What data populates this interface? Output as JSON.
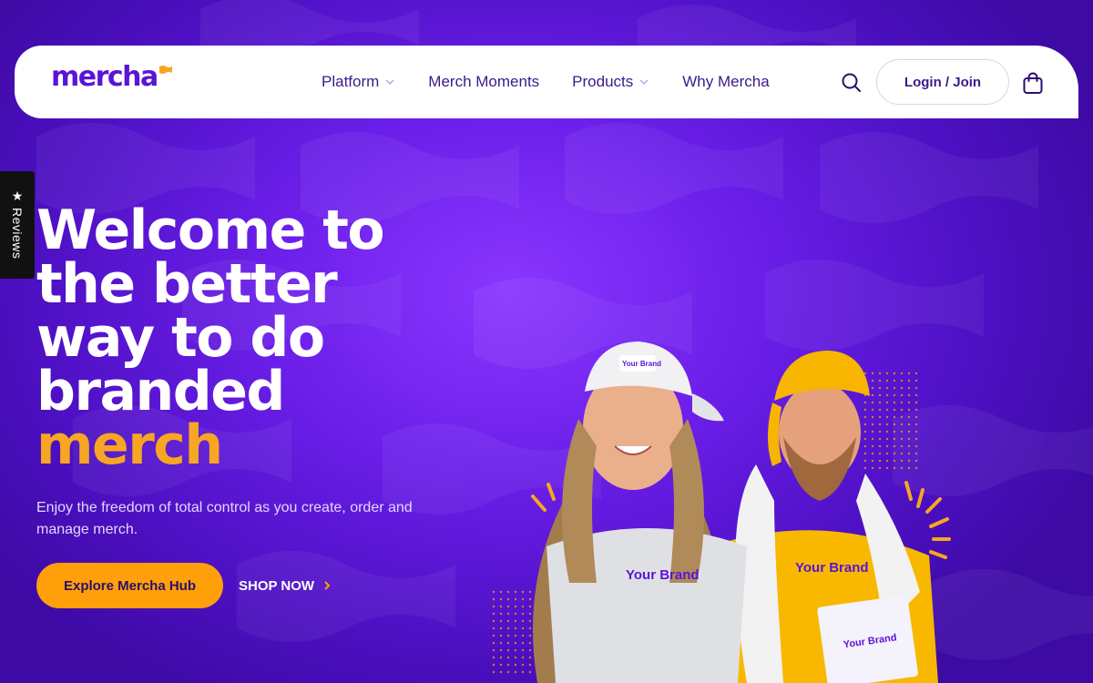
{
  "brand": {
    "name": "mercha",
    "primary_color": "#5a14d6",
    "accent_color": "#f6a623",
    "cta_color": "#ff9f0a"
  },
  "nav": {
    "items": [
      {
        "label": "Platform",
        "has_dropdown": true
      },
      {
        "label": "Merch Moments",
        "has_dropdown": false
      },
      {
        "label": "Products",
        "has_dropdown": true
      },
      {
        "label": "Why Mercha",
        "has_dropdown": false
      }
    ],
    "search_icon": "search-icon",
    "login_label": "Login / Join",
    "cart_icon": "shopping-bag-icon"
  },
  "reviews_tab": {
    "icon": "star-icon",
    "label": "Reviews"
  },
  "hero": {
    "title_lines": [
      "Welcome to",
      "the better",
      "way to do",
      "branded"
    ],
    "title_accent": "merch",
    "subtitle": "Enjoy the freedom of total control as you create, order and manage merch.",
    "primary_cta": "Explore Mercha Hub",
    "secondary_cta": "SHOP NOW",
    "secondary_cta_icon": "chevron-right-icon",
    "image": {
      "cap_text": "Your Brand",
      "woman_shirt_text": "Your Brand",
      "man_shirt_text": "Your Brand",
      "card_text": "Your Brand"
    }
  }
}
